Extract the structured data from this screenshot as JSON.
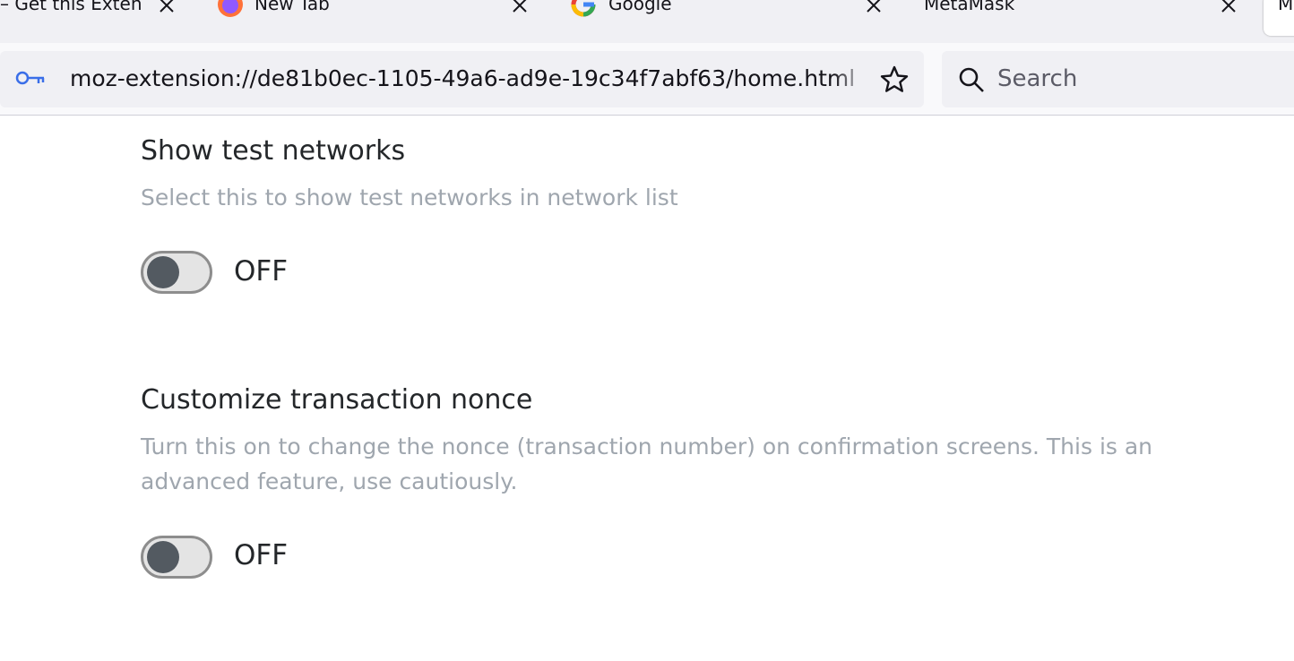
{
  "browser": {
    "tabs": [
      {
        "title": "– Get this Exten"
      },
      {
        "title": "New Tab"
      },
      {
        "title": "Google"
      },
      {
        "title": "MetaMask"
      }
    ],
    "active_tab_title": "M",
    "url": "moz-extension://de81b0ec-1105-49a6-ad9e-19c34f7abf63/home.html",
    "search_placeholder": "Search"
  },
  "settings": [
    {
      "title": "Show test networks",
      "description": "Select this to show test networks in network list",
      "toggle_state": "OFF",
      "enabled": false
    },
    {
      "title": "Customize transaction nonce",
      "description": "Turn this on to change the nonce (transaction number) on confirmation screens. This is an advanced feature, use cautiously.",
      "toggle_state": "OFF",
      "enabled": false
    }
  ],
  "colors": {
    "tabstrip": "#f0f0f4",
    "toolbar": "#f9f9fb",
    "title_text": "#24272a",
    "description_text": "#9fa6ae",
    "toggle_off_knob": "#535a61",
    "toggle_off_track": "#e4e4e4",
    "key_icon": "#3a6ee8"
  }
}
